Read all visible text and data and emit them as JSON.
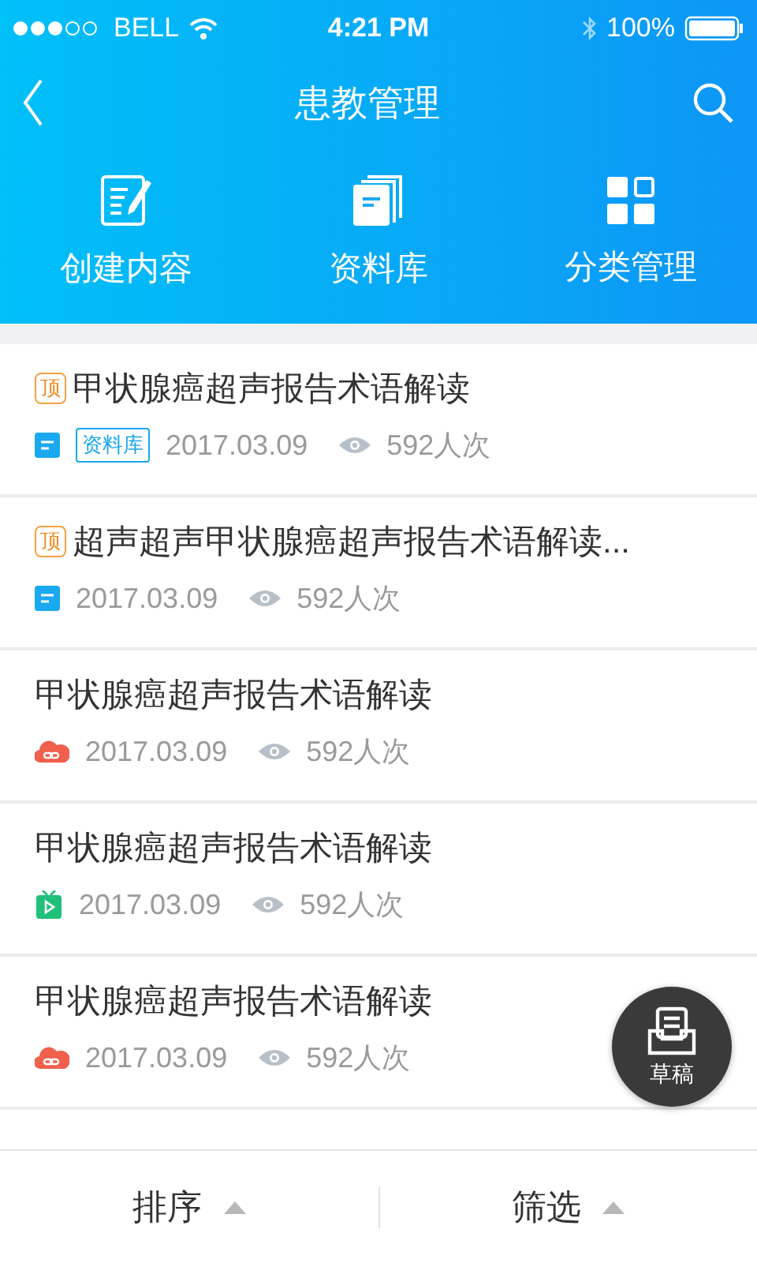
{
  "status_bar": {
    "carrier": "BELL",
    "time": "4:21 PM",
    "battery": "100%"
  },
  "header": {
    "title": "患教管理"
  },
  "actions": [
    {
      "label": "创建内容",
      "kind": "create"
    },
    {
      "label": "资料库",
      "kind": "library"
    },
    {
      "label": "分类管理",
      "kind": "category"
    }
  ],
  "items": [
    {
      "title": "甲状腺癌超声报告术语解读",
      "pin": "顶",
      "kind": "document",
      "tag": "资料库",
      "date": "2017.03.09",
      "views": "592人次"
    },
    {
      "title": "超声超声甲状腺癌超声报告术语解读...",
      "pin": "顶",
      "kind": "document",
      "date": "2017.03.09",
      "views": "592人次"
    },
    {
      "title": "甲状腺癌超声报告术语解读",
      "kind": "link",
      "date": "2017.03.09",
      "views": "592人次"
    },
    {
      "title": "甲状腺癌超声报告术语解读",
      "kind": "video",
      "date": "2017.03.09",
      "views": "592人次"
    },
    {
      "title": "甲状腺癌超声报告术语解读",
      "kind": "link",
      "date": "2017.03.09",
      "views": "592人次"
    }
  ],
  "draft_button": {
    "label": "草稿"
  },
  "bottom_bar": [
    {
      "label": "排序"
    },
    {
      "label": "筛选"
    }
  ]
}
